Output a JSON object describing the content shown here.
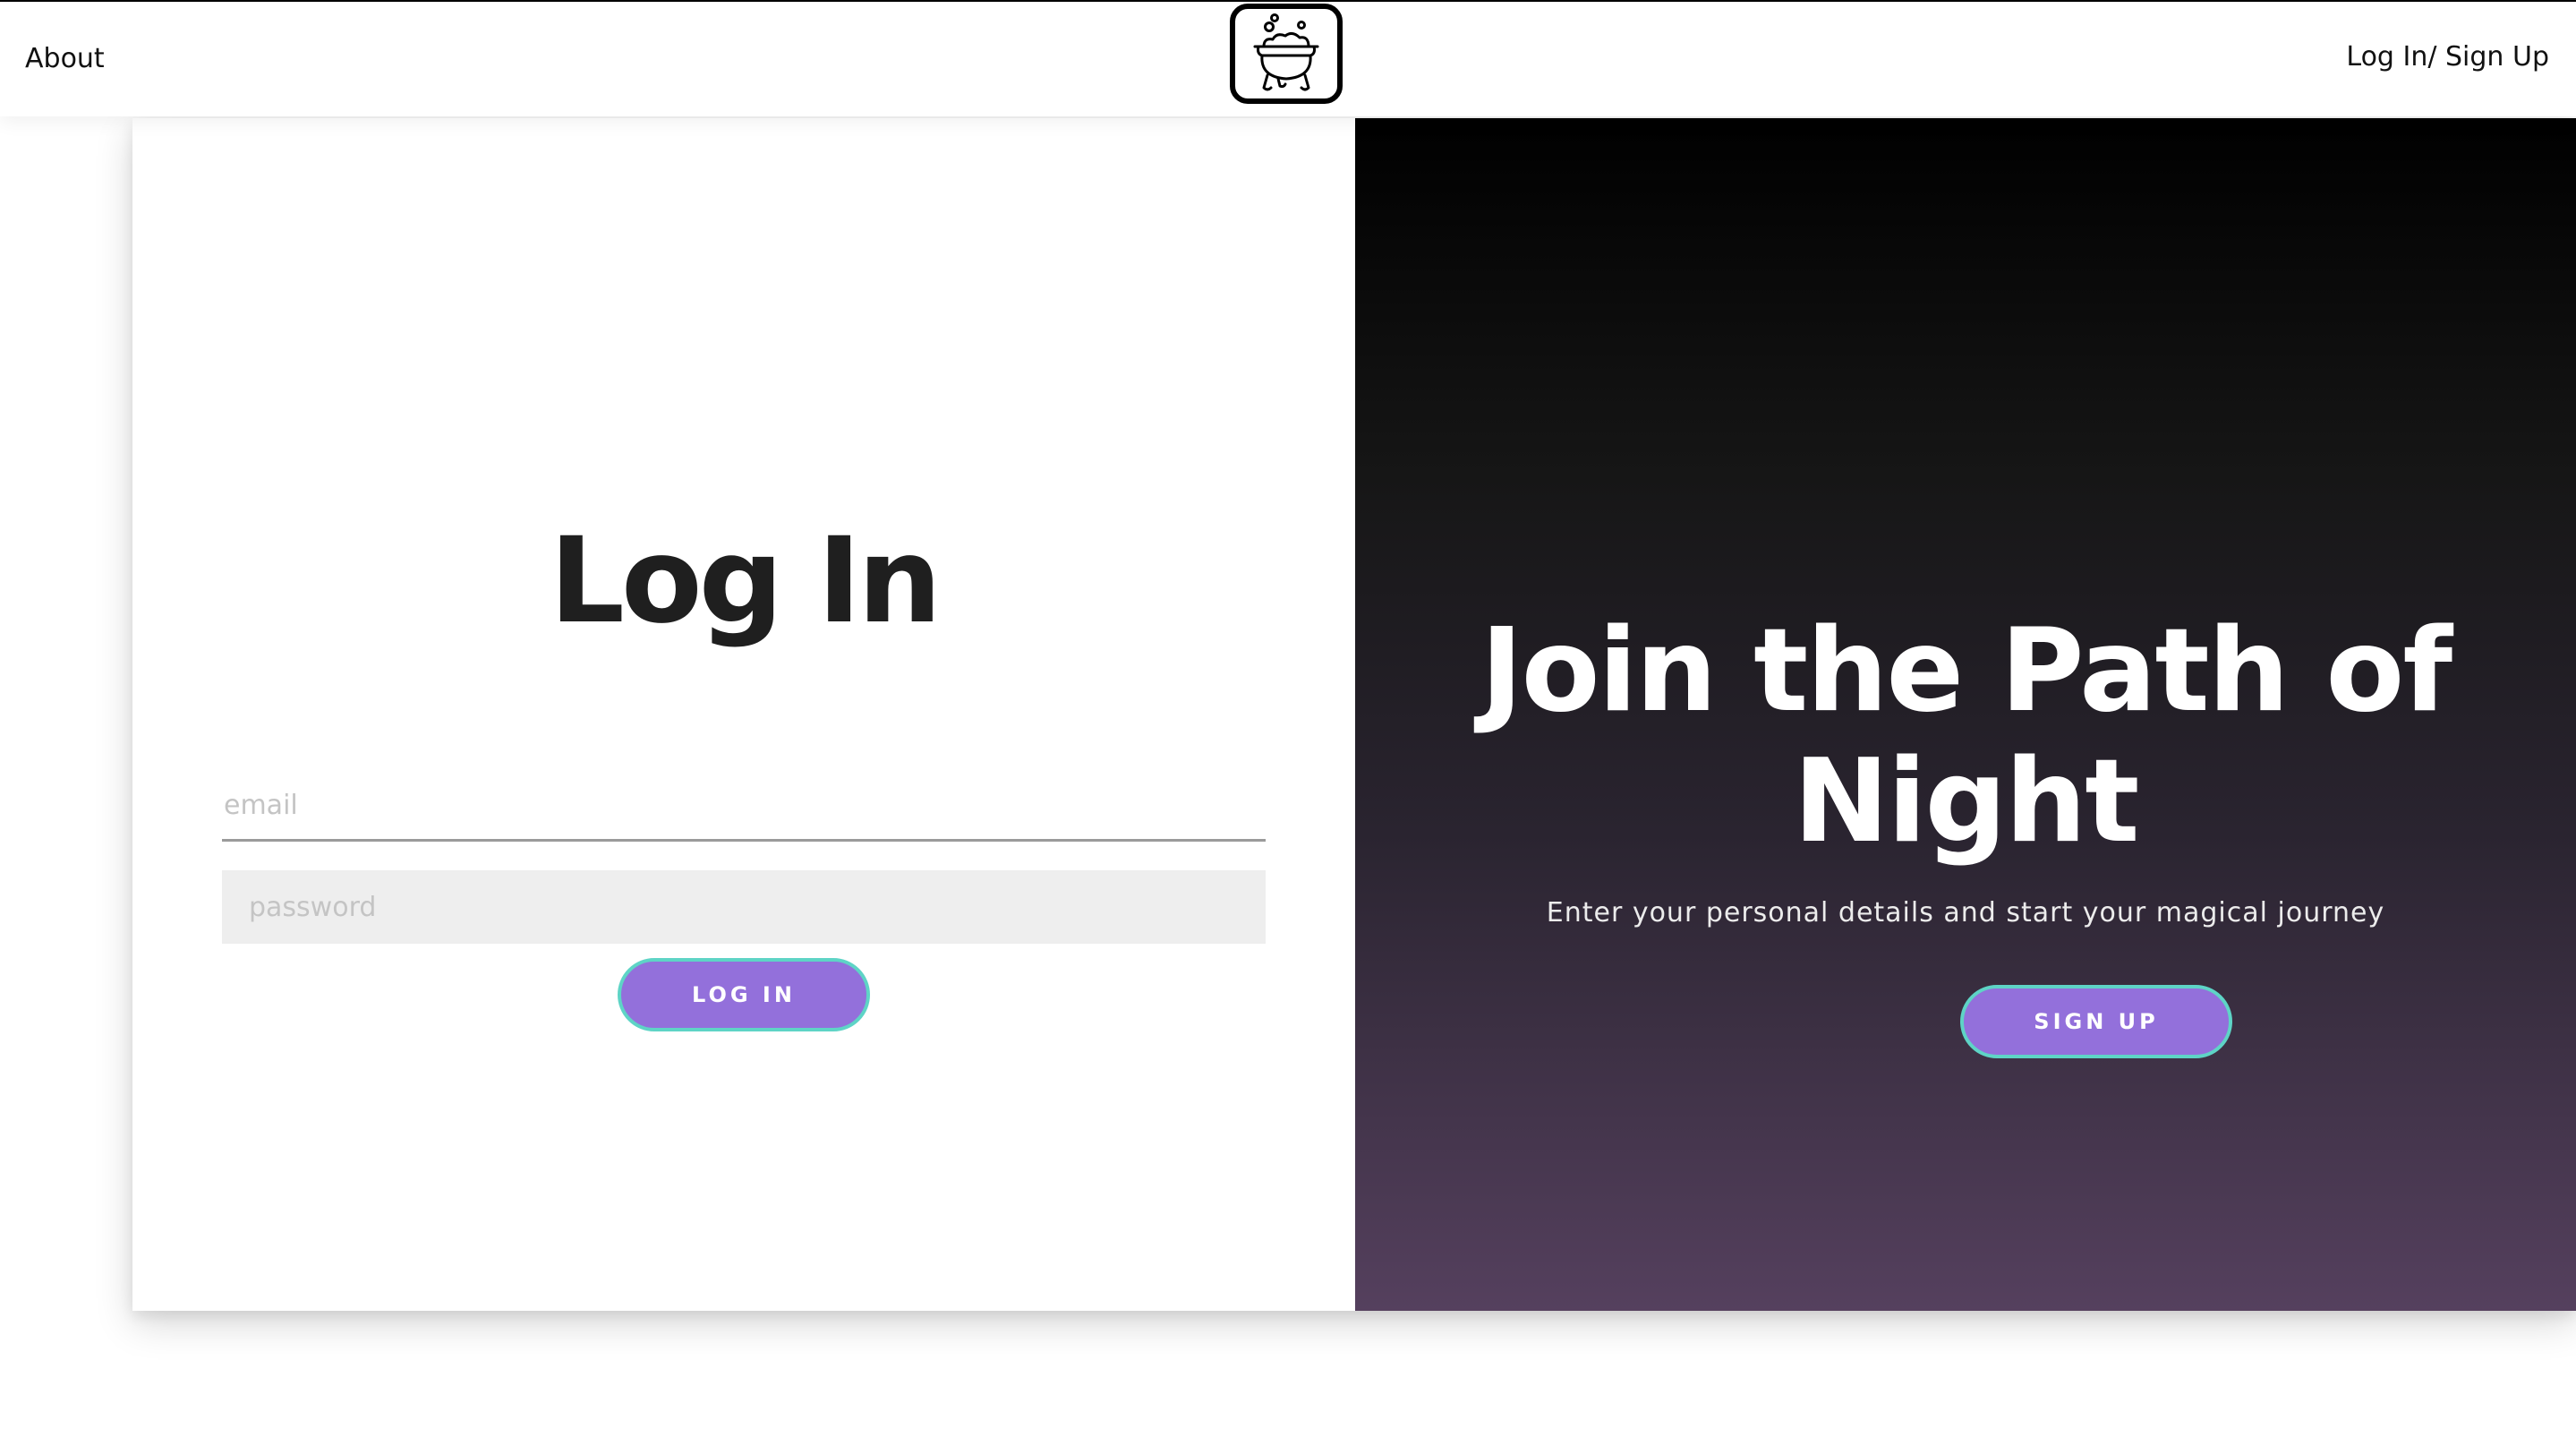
{
  "header": {
    "about_label": "About",
    "auth_label": "Log In/ Sign Up",
    "logo_icon": "cauldron-icon"
  },
  "login": {
    "title": "Log In",
    "email_placeholder": "email",
    "password_placeholder": "password",
    "button_label": "LOG IN"
  },
  "signup": {
    "title": "Join the Path of Night",
    "subtitle": "Enter your personal details and start your magical journey",
    "button_label": "SIGN UP"
  },
  "colors": {
    "accent": "#9370db",
    "button_border": "#5ed4c6",
    "gradient_top": "#000000",
    "gradient_bottom": "#55405e"
  }
}
